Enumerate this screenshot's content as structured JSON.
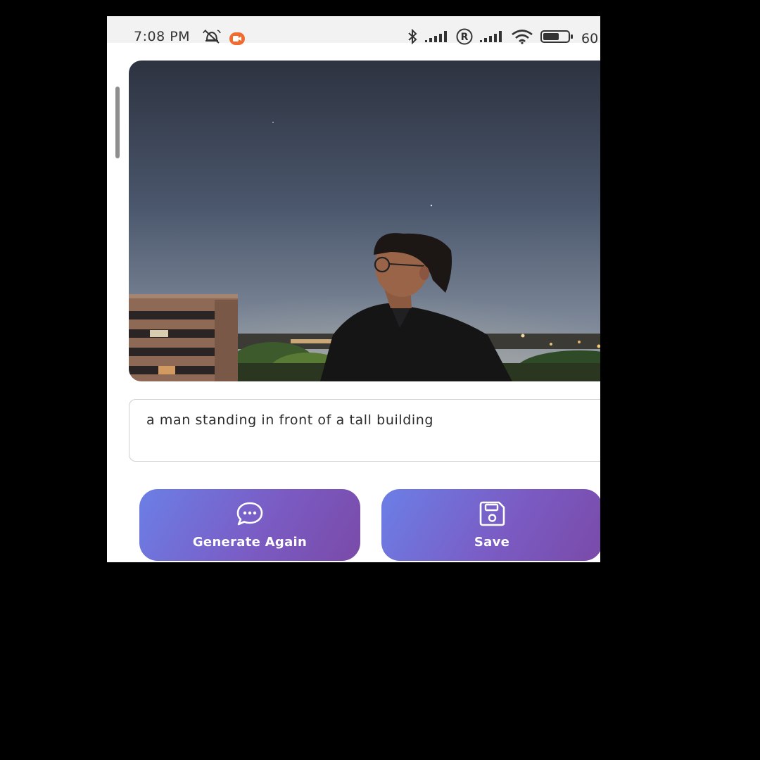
{
  "status_bar": {
    "time": "7:08 PM",
    "icons_left": [
      "alarm-off-icon",
      "screen-record-icon"
    ],
    "icons_right": [
      "bluetooth-icon",
      "signal-icon",
      "roaming-icon",
      "signal-icon",
      "wifi-icon",
      "battery-icon"
    ],
    "battery_text": "60",
    "roaming_glyph": "R"
  },
  "photo": {
    "description_icon": "photo-image"
  },
  "caption": {
    "text": "a man standing in front of a tall building"
  },
  "actions": {
    "generate_label": "Generate Again",
    "generate_icon": "chat-dots-icon",
    "save_label": "Save",
    "save_icon": "floppy-disk-icon"
  },
  "colors": {
    "button_gradient_start": "#6b7fe6",
    "button_gradient_end": "#7a4aa8",
    "recording_badge": "#f26b2e"
  }
}
